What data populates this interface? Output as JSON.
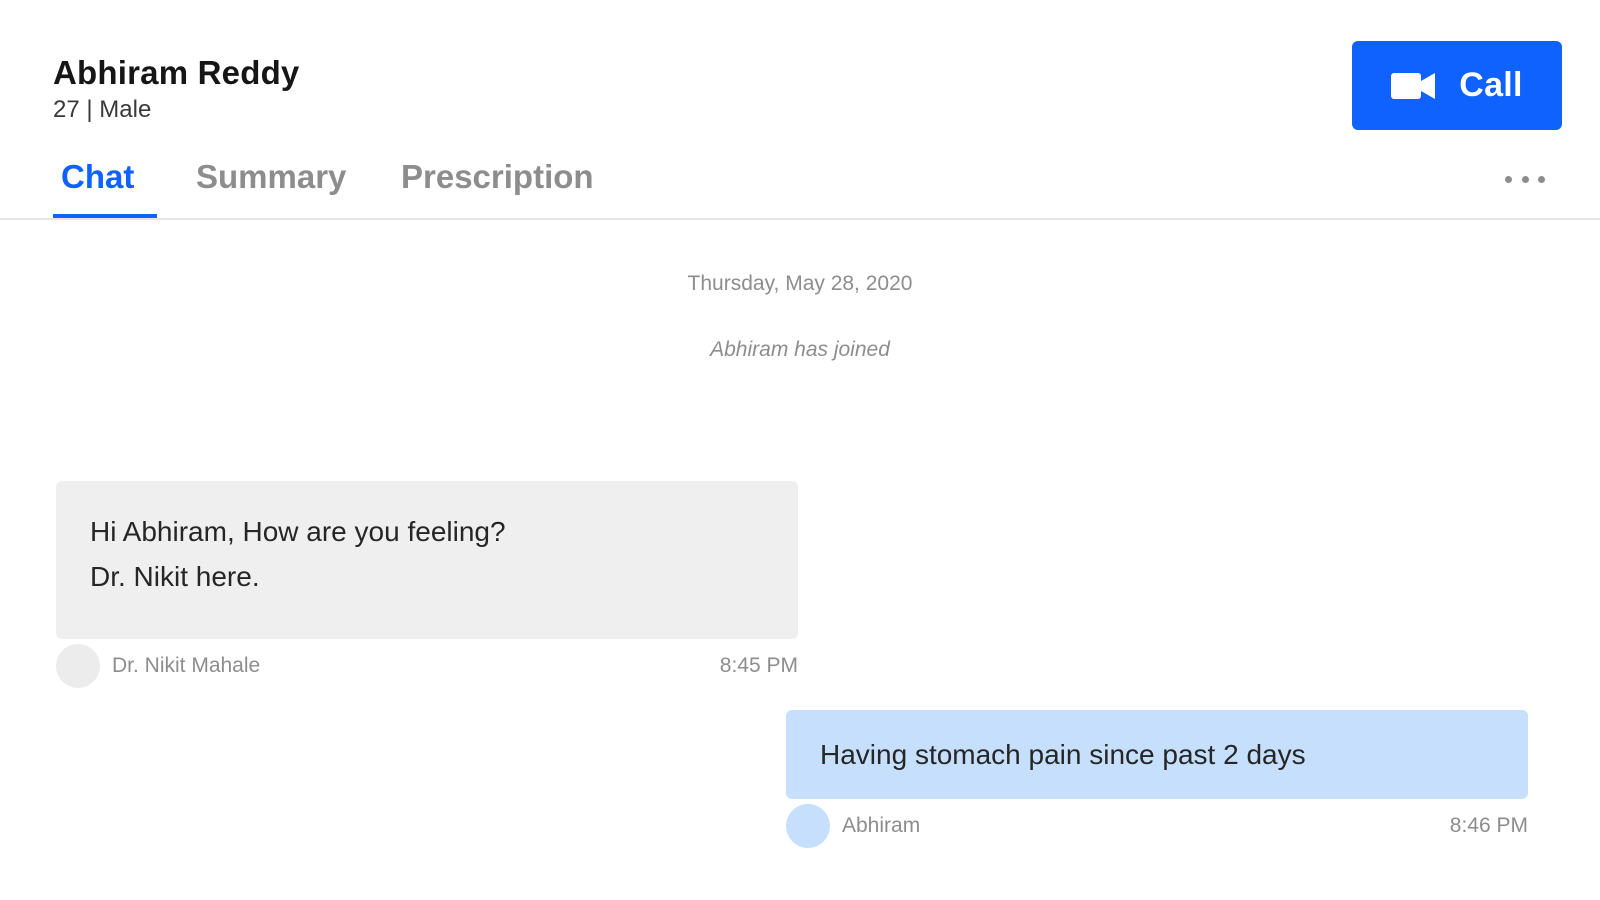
{
  "patient": {
    "name": "Abhiram Reddy",
    "meta": "27 | Male"
  },
  "actions": {
    "call_label": "Call",
    "call_icon": "video-camera-icon",
    "more_icon": "more-horizontal-icon"
  },
  "tabs": [
    {
      "label": "Chat",
      "active": true
    },
    {
      "label": "Summary",
      "active": false
    },
    {
      "label": "Prescription",
      "active": false
    }
  ],
  "chat": {
    "date": "Thursday, May 28, 2020",
    "system_message": "Abhiram has joined",
    "messages": [
      {
        "direction": "incoming",
        "lines": [
          "Hi Abhiram, How are you feeling?",
          "Dr. Nikit here."
        ],
        "sender": "Dr. Nikit Mahale",
        "time": "8:45 PM"
      },
      {
        "direction": "outgoing",
        "lines": [
          "Having stomach pain since past 2 days"
        ],
        "sender": "Abhiram",
        "time": "8:46 PM"
      }
    ]
  },
  "colors": {
    "accent": "#0f62fe",
    "incoming_bubble": "#efefef",
    "outgoing_bubble": "#c5dffd",
    "muted_text": "#8d8d8d"
  }
}
